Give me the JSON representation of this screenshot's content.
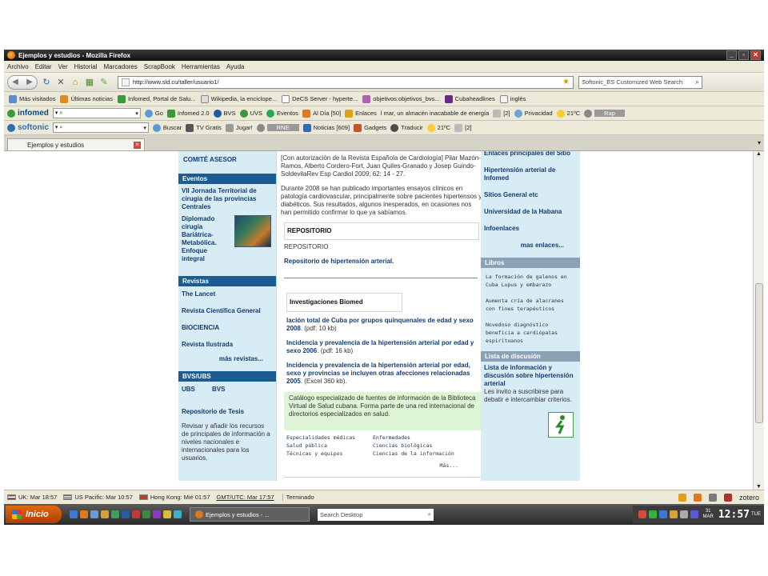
{
  "window": {
    "title": "Ejemplos y estudios - Mozilla Firefox"
  },
  "menu": [
    "Archivo",
    "Editar",
    "Ver",
    "Historial",
    "Marcadores",
    "ScrapBook",
    "Herramientas",
    "Ayuda"
  ],
  "address": {
    "url": "http://www.sld.cu/taller/usuario1/",
    "search_placeholder": "Softonic_ES Customized Web Search"
  },
  "bookmarks": [
    "Más visitados",
    "Últimas noticias",
    "Infomed, Portal de Salu...",
    "Wikipedia, la enciclope...",
    "DeCS Server - hyperte...",
    "objetivos:objetivos_bvs...",
    "Cubaheadlines",
    "inglés"
  ],
  "toolbar_infomed": {
    "brand": "infomed",
    "items": [
      "Go",
      "Infomed 2.0",
      "BVS",
      "UVS",
      "Eventos",
      "Al Día [50]",
      "Enlaces"
    ],
    "ticker": "l mar, un almacén inacabable de energía",
    "rest": [
      "[2]",
      "Privacidad",
      "21ºC"
    ],
    "rap": "Rap"
  },
  "toolbar_softonic": {
    "brand": "softonic",
    "items": [
      "Buscar",
      "TV Gratis",
      "Jugar!",
      "RNE",
      "Noticias [609]",
      "Gadgets",
      "Traducir",
      "21ºC",
      "[2]"
    ]
  },
  "tab": {
    "label": "Ejemplos y estudios"
  },
  "left": {
    "comite": "COMITÉ ASESOR",
    "eventos_head": "Eventos",
    "evento1": "VII Jornada Territorial de cirugía de las provincias Centrales",
    "evento2": "Diplomado cirugía Bariátrica-Metabólica. Enfoque integral",
    "revistas_head": "Revistas",
    "revistas": [
      "The Lancet",
      "Revista Científica General",
      "BIOCIENCIA",
      "Revista Ilustrada"
    ],
    "mas_revistas": "más revistas...",
    "bvs_head": "BVS/UBS",
    "ubs": "UBS",
    "bvs": "BVS",
    "tesis": "Repositorio de Tesis",
    "tesis_text": "Revisar y añadir los recursos de principales de información a niveles nacionales e internacionales para los usuarios."
  },
  "middle": {
    "para1": "[Con autorización de la Revista Española de Cardiología] Pilar Mazón-Ramos, Alberto Cordero-Fort, Juan Quiles-Granado y Josep Guindo-SoldevilaRev Esp Cardiol 2009; 62: 14 - 27.",
    "para2": "Durante 2008 se han publicado importantes ensayos clínicos en patología cardiovascular, principalmente sobre pacientes hipertensos y diabéticos. Sus resultados, algunos inesperados, en ocasiones nos han permitido confirmar lo que ya sabíamos.",
    "repo_head": "REPOSITORIO",
    "repo_sub": "REPOSITORIO",
    "repo_link": "Repositorio de hipertensión arterial.",
    "inv_head": "Investigaciones Biomed",
    "inv1_link": "lación total de Cuba por grupos quinquenales de edad y sexo 2008",
    "inv1_tail": ". (pdf: 10 kb)",
    "inv2_link": "Incidencia y prevalencia de la hipertensión arterial por edad y sexo 2006",
    "inv2_tail": ". (pdf: 16 kb)",
    "inv3_link": "Incidencia y prevalencia de la hipertensión arterial por edad, sexo y provincias se incluyen otras afecciones relacionadas 2005",
    "inv3_tail": ". (Excel 360 kb).",
    "catalog": "Catálogo especializado de fuentes de información de la Biblioteca Virtual de Salud cubana. Forma parte de una red internacional de directorios especializados en salud.",
    "cat_links": [
      "Especialidades médicas",
      "Enfermedades",
      "Salud pública",
      "Ciencias biológicas",
      "Técnicas y equipos",
      "Ciencias de la información"
    ],
    "mas": "Más..."
  },
  "right": {
    "enlaces_top": "Enlaces principales del Sitio",
    "links": [
      "Hipertensión arterial de Infomed",
      "Sitios General etc",
      "Universidad de la Habana",
      "Infoenlaces"
    ],
    "mas_enlaces": "mas enlaces...",
    "libros_head": "Libros",
    "libros": [
      "La formación de galenos en Cuba Lupus y embarazo",
      "Aumenta cría de alacranes con fines terapéuticos",
      "Novedoso diagnóstico beneficia a cardiópatas espirituanos"
    ],
    "lista_head": "Lista de discusión",
    "lista_link": "Lista de información y discusión sobre hipertensión arterial",
    "lista_text": "Les invito a suscribirse para debatir e intercambiar criterios."
  },
  "status": {
    "clocks": [
      "UK: Mar 18:57",
      "US Pacific: Mar 10:57",
      "Hong Kong: Mié 01:57",
      "GMT/UTC: Mar 17:57"
    ],
    "state": "Terminado",
    "zotero": "zotero"
  },
  "taskbar": {
    "start": "Inicio",
    "task": "Ejemplos y estudios - ...",
    "search": "Search Desktop",
    "date_top": "31",
    "date_bottom": "MAR",
    "time": "12:57",
    "day": "TUE"
  }
}
